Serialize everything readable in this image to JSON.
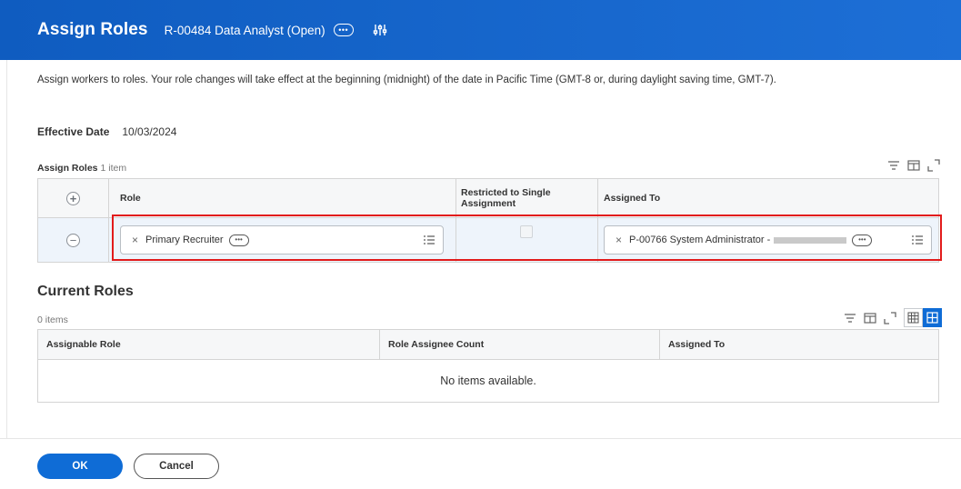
{
  "header": {
    "title": "Assign Roles",
    "subtitle": "R-00484 Data Analyst (Open)",
    "accent": "#0f5cc0"
  },
  "instructions": "Assign workers to roles. Your role changes will take effect at the beginning (midnight) of the date in Pacific Time (GMT-8 or, during daylight saving time, GMT-7).",
  "effective_date": {
    "label": "Effective Date",
    "value": "10/03/2024"
  },
  "assign_roles_grid": {
    "caption": "Assign Roles",
    "count": "1 item",
    "columns": [
      "Role",
      "Restricted to Single Assignment",
      "Assigned To"
    ],
    "rows": [
      {
        "role": "Primary Recruiter",
        "restricted": false,
        "assigned_to": "P-00766 System Administrator -"
      }
    ]
  },
  "current_roles": {
    "title": "Current Roles",
    "count": "0 items",
    "columns": [
      "Assignable Role",
      "Role Assignee Count",
      "Assigned To"
    ],
    "empty_message": "No items available."
  },
  "footer": {
    "ok": "OK",
    "cancel": "Cancel"
  },
  "colors": {
    "primary": "#0f6cd6",
    "highlight": "#e21b1b"
  }
}
